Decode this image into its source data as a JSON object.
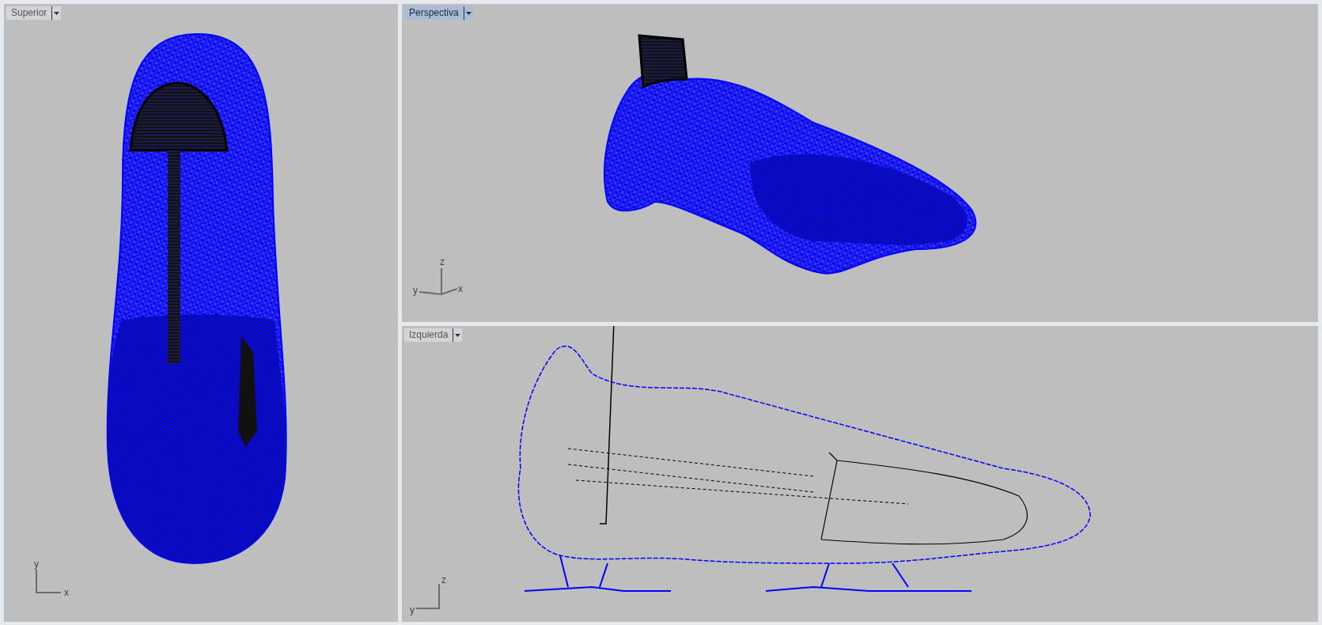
{
  "viewports": [
    {
      "title": "Superior",
      "selected": false,
      "kind": "top",
      "axes": [
        "y",
        "x"
      ]
    },
    {
      "title": "Perspectiva",
      "selected": true,
      "kind": "perspective",
      "axes": [
        "z",
        "y",
        "x"
      ]
    },
    {
      "title": "Izquierda",
      "selected": false,
      "kind": "side",
      "axes": [
        "z",
        "y"
      ]
    }
  ]
}
